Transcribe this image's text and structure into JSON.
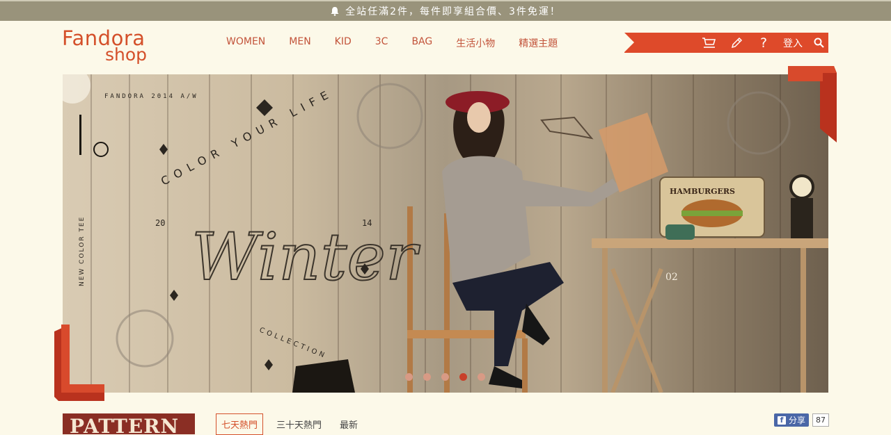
{
  "promo": {
    "text": "全站任滿2件，每件即享組合價、3件免運！"
  },
  "logo": {
    "line1": "Fandora",
    "line2": "shop"
  },
  "nav": {
    "items": [
      "WOMEN",
      "MEN",
      "KID",
      "3C",
      "BAG",
      "生活小物",
      "精選主題"
    ]
  },
  "toolbar": {
    "login": "登入",
    "icons": [
      "cart-icon",
      "pencil-icon",
      "help-icon",
      "search-icon"
    ]
  },
  "hero": {
    "label_top": "FANDORA 2014 A/W",
    "headline": "COLOR YOUR LIFE",
    "script": "Winter",
    "sub": "COLLECTION",
    "year_left": "20",
    "year_right": "14",
    "sign": "HAMBURGERS",
    "side": "NEW COLOR TEE",
    "no": "02",
    "slide_count": 5,
    "active_slide": 4
  },
  "pattern": {
    "label": "PATTERN"
  },
  "tabs": {
    "items": [
      "七天熱門",
      "三十天熱門",
      "最新"
    ],
    "active": 0
  },
  "share": {
    "label": "分享",
    "count": "87"
  },
  "colors": {
    "accent": "#de4a2a",
    "promo_bar": "#99937b",
    "background": "#fcf9e9"
  }
}
